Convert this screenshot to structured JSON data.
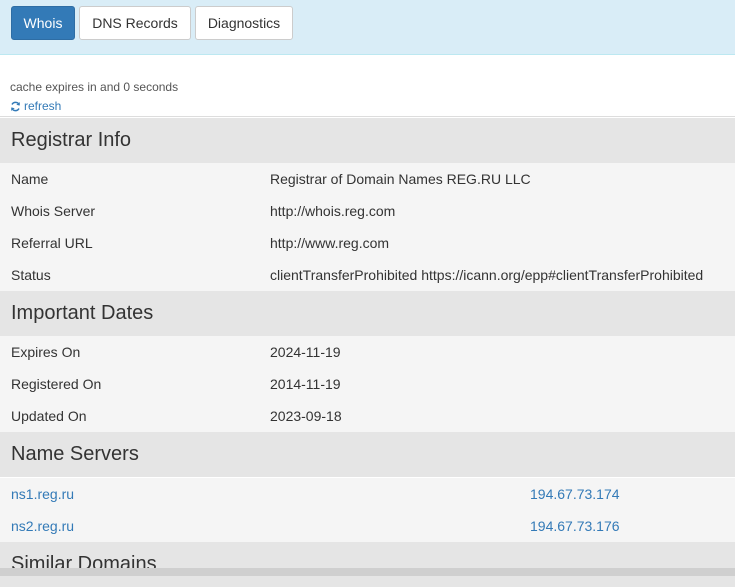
{
  "tabs": [
    {
      "label": "Whois",
      "active": true
    },
    {
      "label": "DNS Records",
      "active": false
    },
    {
      "label": "Diagnostics",
      "active": false
    }
  ],
  "cache_text": "cache expires in and 0 seconds",
  "refresh_label": "refresh",
  "refresh_icon": "refresh-icon",
  "colors": {
    "accent": "#337ab7",
    "tabbar_bg": "#d9edf7",
    "section_bg": "#e5e5e5",
    "row_bg": "#f5f5f5"
  },
  "sections": {
    "registrar": {
      "title": "Registrar Info",
      "rows": [
        {
          "key": "Name",
          "value": "Registrar of Domain Names REG.RU LLC"
        },
        {
          "key": "Whois Server",
          "value": "http://whois.reg.com"
        },
        {
          "key": "Referral URL",
          "value": "http://www.reg.com"
        },
        {
          "key": "Status",
          "value": "clientTransferProhibited https://icann.org/epp#clientTransferProhibited"
        }
      ]
    },
    "dates": {
      "title": "Important Dates",
      "rows": [
        {
          "key": "Expires On",
          "value": "2024-11-19"
        },
        {
          "key": "Registered On",
          "value": "2014-11-19"
        },
        {
          "key": "Updated On",
          "value": "2023-09-18"
        }
      ]
    },
    "nameservers": {
      "title": "Name Servers",
      "rows": [
        {
          "host": "ns1.reg.ru",
          "ip": "194.67.73.174"
        },
        {
          "host": "ns2.reg.ru",
          "ip": "194.67.73.176"
        }
      ]
    },
    "similar": {
      "title": "Similar Domains"
    }
  }
}
